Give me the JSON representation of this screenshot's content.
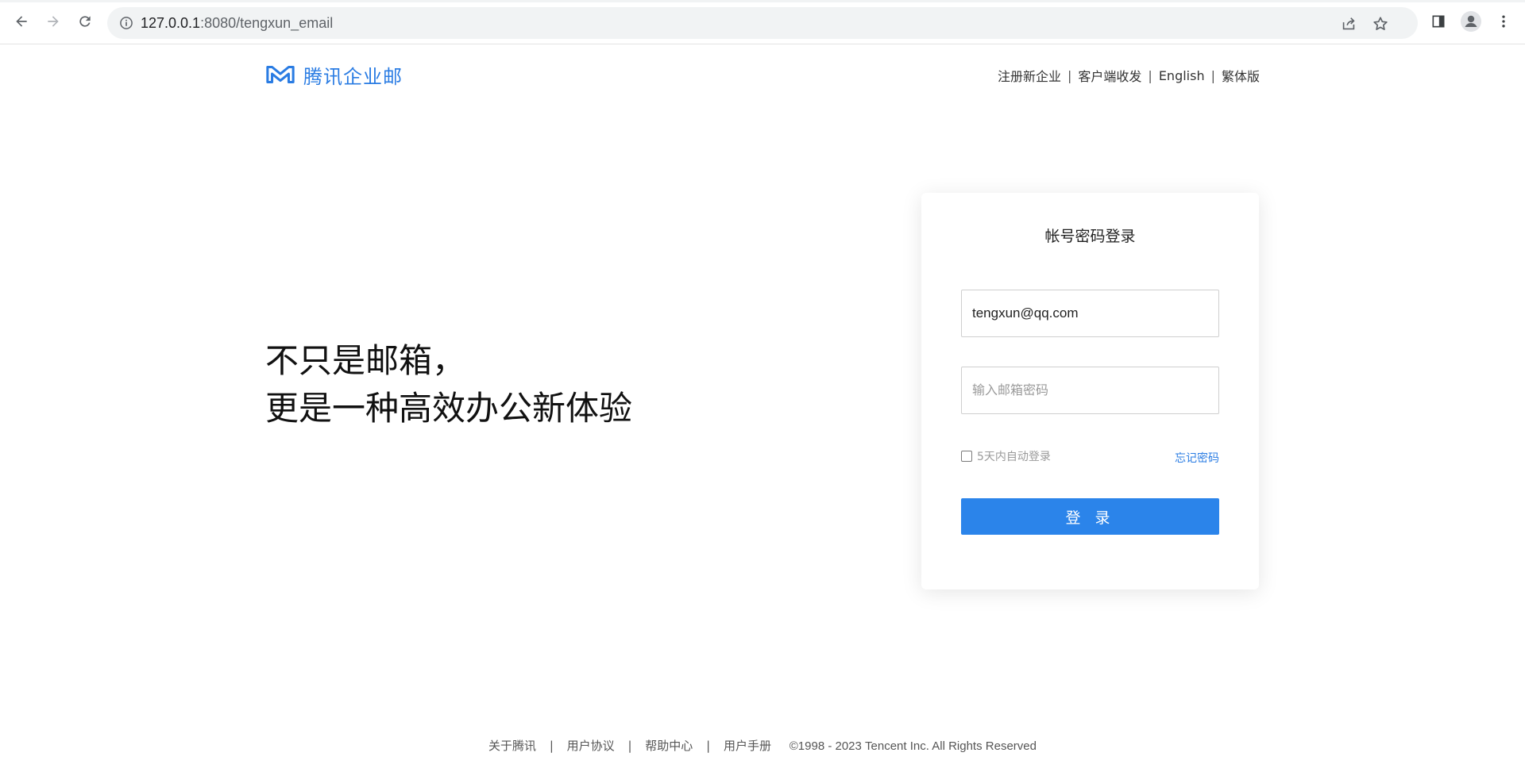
{
  "browser": {
    "url_host": "127.0.0.1",
    "url_path": ":8080/tengxun_email"
  },
  "header": {
    "brand": "腾讯企业邮",
    "links": [
      {
        "label": "注册新企业"
      },
      {
        "label": "客户端收发"
      },
      {
        "label": "English"
      },
      {
        "label": "繁体版"
      }
    ],
    "separator": "|"
  },
  "slogan": {
    "line1": "不只是邮箱，",
    "line2": "更是一种高效办公新体验"
  },
  "login": {
    "title": "帐号密码登录",
    "email_value": "tengxun@qq.com",
    "password_placeholder": "输入邮箱密码",
    "remember_label": "5天内自动登录",
    "forgot_label": "忘记密码",
    "submit_label": "登 录"
  },
  "footer": {
    "links": [
      {
        "label": "关于腾讯"
      },
      {
        "label": "用户协议"
      },
      {
        "label": "帮助中心"
      },
      {
        "label": "用户手册"
      }
    ],
    "separator": "|",
    "copyright": "©1998 - 2023 Tencent Inc. All Rights Reserved"
  },
  "colors": {
    "brand_blue": "#2a7ce3",
    "button_blue": "#2b84ea"
  }
}
